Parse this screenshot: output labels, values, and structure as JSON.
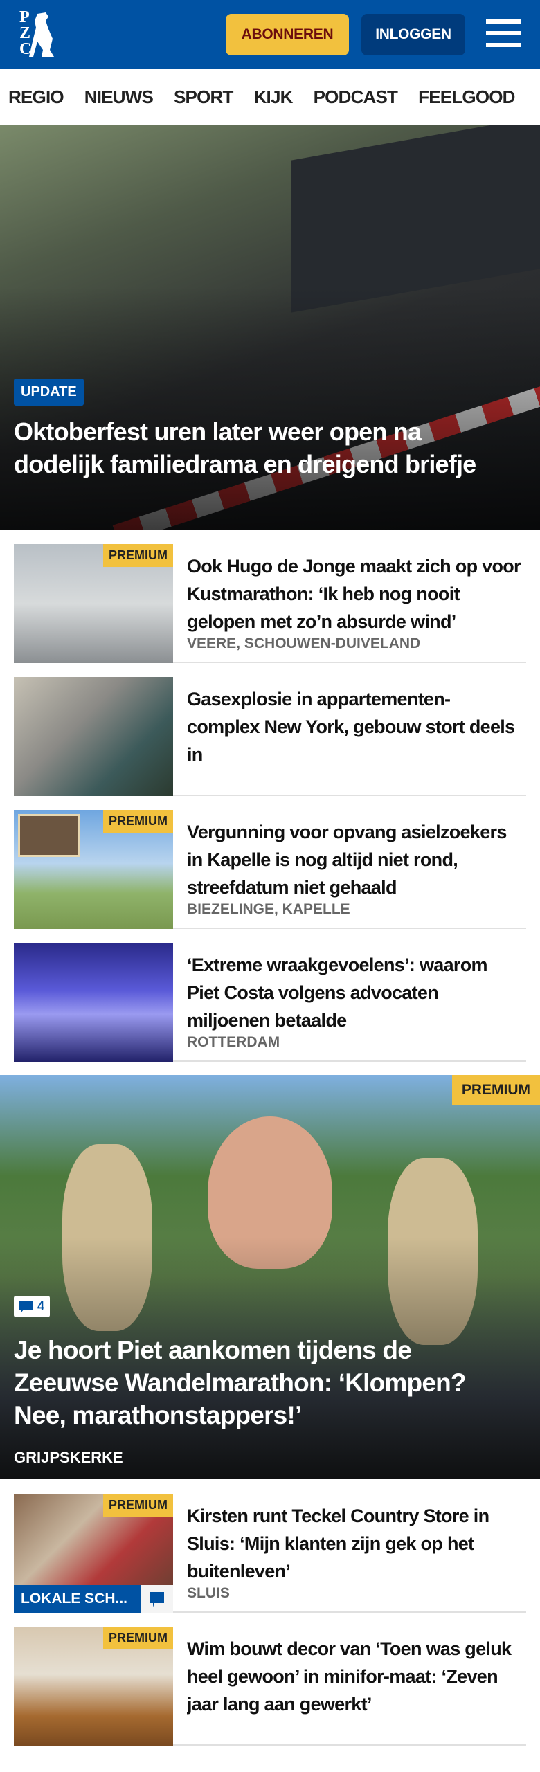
{
  "header": {
    "logo_text": "PZC",
    "subscribe_label": "ABONNEREN",
    "login_label": "INLOGGEN",
    "menu_icon": "hamburger-icon"
  },
  "nav": [
    "REGIO",
    "NIEUWS",
    "SPORT",
    "KIJK",
    "PODCAST",
    "FEELGOOD"
  ],
  "hero": {
    "badge": "UPDATE",
    "title": "Oktoberfest uren later weer open na dodelijk familiedrama en dreigend briefje"
  },
  "articles": [
    {
      "premium": "PREMIUM",
      "title": "Ook Hugo de Jonge maakt zich op voor Kustmarathon: ‘Ik heb nog nooit gelopen met zo’n absurde wind’",
      "location": "VEERE, SCHOUWEN-DUIVELAND"
    },
    {
      "title": "Gasexplosie in appartementen-complex New York, gebouw stort deels in"
    },
    {
      "premium": "PREMIUM",
      "title": "Vergunning voor opvang asielzoekers in Kapelle is nog altijd niet rond, streefdatum niet gehaald",
      "location": "BIEZELINGE, KAPELLE"
    },
    {
      "title": "‘Extreme wraakgevoelens’: waarom Piet Costa volgens advocaten miljoenen betaalde",
      "location": "ROTTERDAM"
    }
  ],
  "hero2": {
    "premium": "PREMIUM",
    "comments": "4",
    "title": "Je hoort Piet aankomen tijdens de Zeeuwse Wandelmarathon: ‘Klompen? Nee, marathonstappers!’",
    "location": "GRIJPSKERKE"
  },
  "articles2": [
    {
      "premium": "PREMIUM",
      "label": "LOKALE SCH...",
      "title": "Kirsten runt Teckel Country Store in Sluis: ‘Mijn klanten zijn gek op het buitenleven’",
      "location": "SLUIS"
    },
    {
      "premium": "PREMIUM",
      "title": "Wim bouwt decor van ‘Toen was geluk heel gewoon’ in minifor-maat: ‘Zeven jaar lang aan gewerkt’"
    }
  ]
}
